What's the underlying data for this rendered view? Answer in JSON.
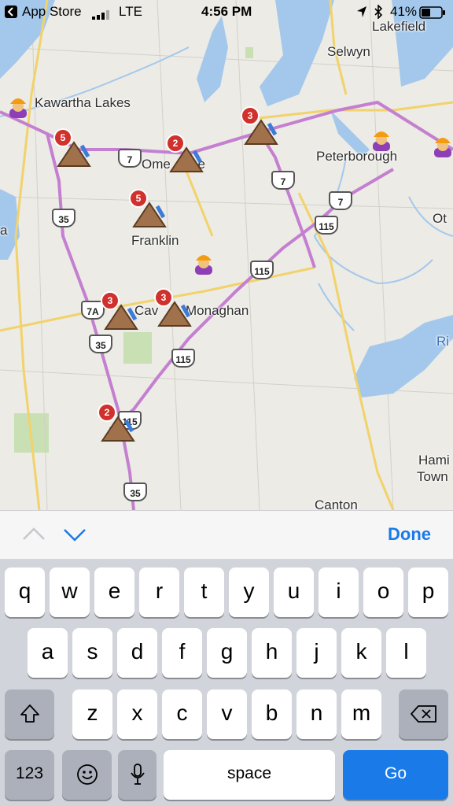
{
  "status_bar": {
    "back_app": "App Store",
    "carrier": "LTE",
    "time": "4:56 PM",
    "battery": "41%"
  },
  "map": {
    "places": [
      "Lakefield",
      "Selwyn",
      "Kawartha Lakes",
      "Peterborough",
      "Ome",
      "ee",
      "Franklin",
      "Cav",
      "Monaghan",
      "Ot",
      "a",
      "Hami",
      "Town",
      "Canton",
      "Ri"
    ],
    "highway_shields": [
      "7",
      "7",
      "7",
      "35",
      "115",
      "115",
      "7A",
      "35",
      "115",
      "115",
      "35"
    ],
    "hill_badges": [
      "5",
      "2",
      "3",
      "5",
      "3",
      "3",
      "2"
    ],
    "colors": {
      "land": "#ecebe5",
      "water": "#a4c8ec",
      "park": "#c8e0b4",
      "hwy_pink": "#c47fd0",
      "road_yellow": "#f2d26a"
    }
  },
  "accessory_bar": {
    "done_label": "Done",
    "prev_icon": "chevron-up-icon",
    "next_icon": "chevron-down-icon"
  },
  "keyboard": {
    "row1": [
      "q",
      "w",
      "e",
      "r",
      "t",
      "y",
      "u",
      "i",
      "o",
      "p"
    ],
    "row2": [
      "a",
      "s",
      "d",
      "f",
      "g",
      "h",
      "j",
      "k",
      "l"
    ],
    "row3": [
      "z",
      "x",
      "c",
      "v",
      "b",
      "n",
      "m"
    ],
    "numbers_label": "123",
    "space_label": "space",
    "go_label": "Go"
  }
}
